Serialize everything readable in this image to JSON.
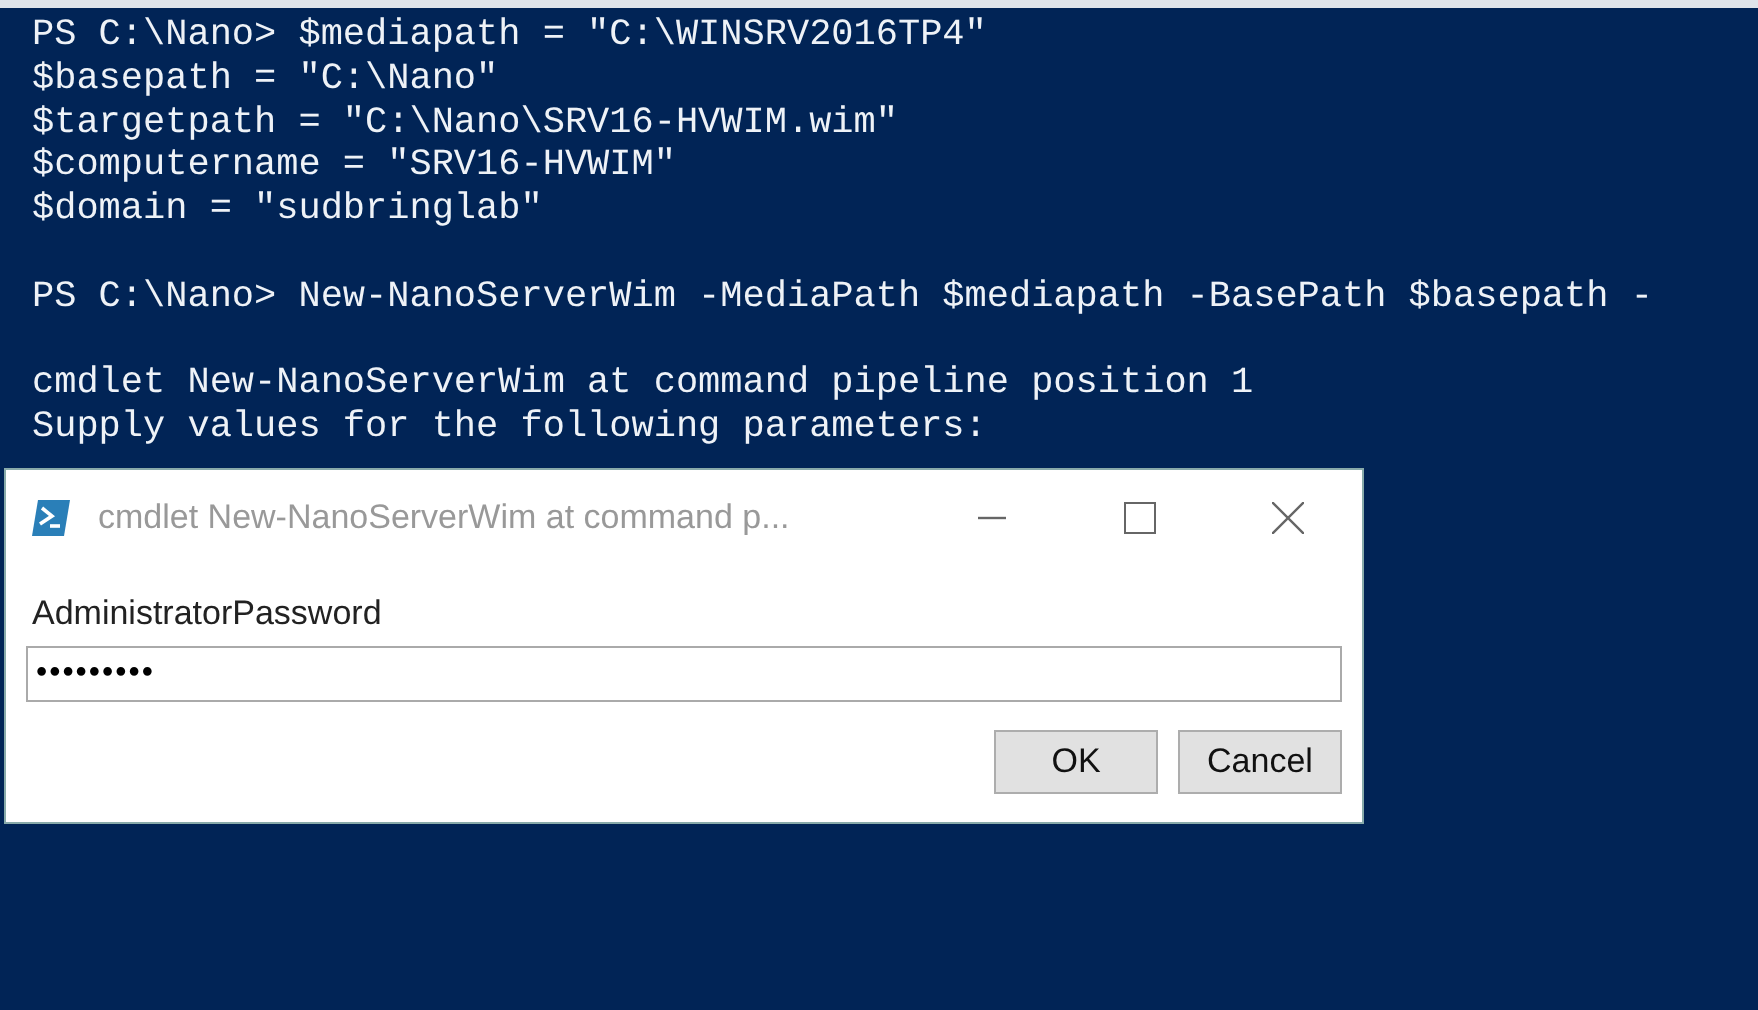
{
  "console": {
    "blocks": [
      [
        "PS C:\\Nano> $mediapath = \"C:\\WINSRV2016TP4\"",
        "$basepath = \"C:\\Nano\"",
        "$targetpath = \"C:\\Nano\\SRV16-HVWIM.wim\"",
        "$computername = \"SRV16-HVWIM\"",
        "$domain = \"sudbringlab\""
      ],
      [
        "PS C:\\Nano> New-NanoServerWim -MediaPath $mediapath -BasePath $basepath -"
      ],
      [
        "cmdlet New-NanoServerWim at command pipeline position 1",
        "Supply values for the following parameters:"
      ]
    ]
  },
  "dialog": {
    "title": "cmdlet New-NanoServerWim at command p...",
    "label": "AdministratorPassword",
    "value": "•••••••••",
    "buttons": [
      "OK",
      "Cancel"
    ]
  }
}
